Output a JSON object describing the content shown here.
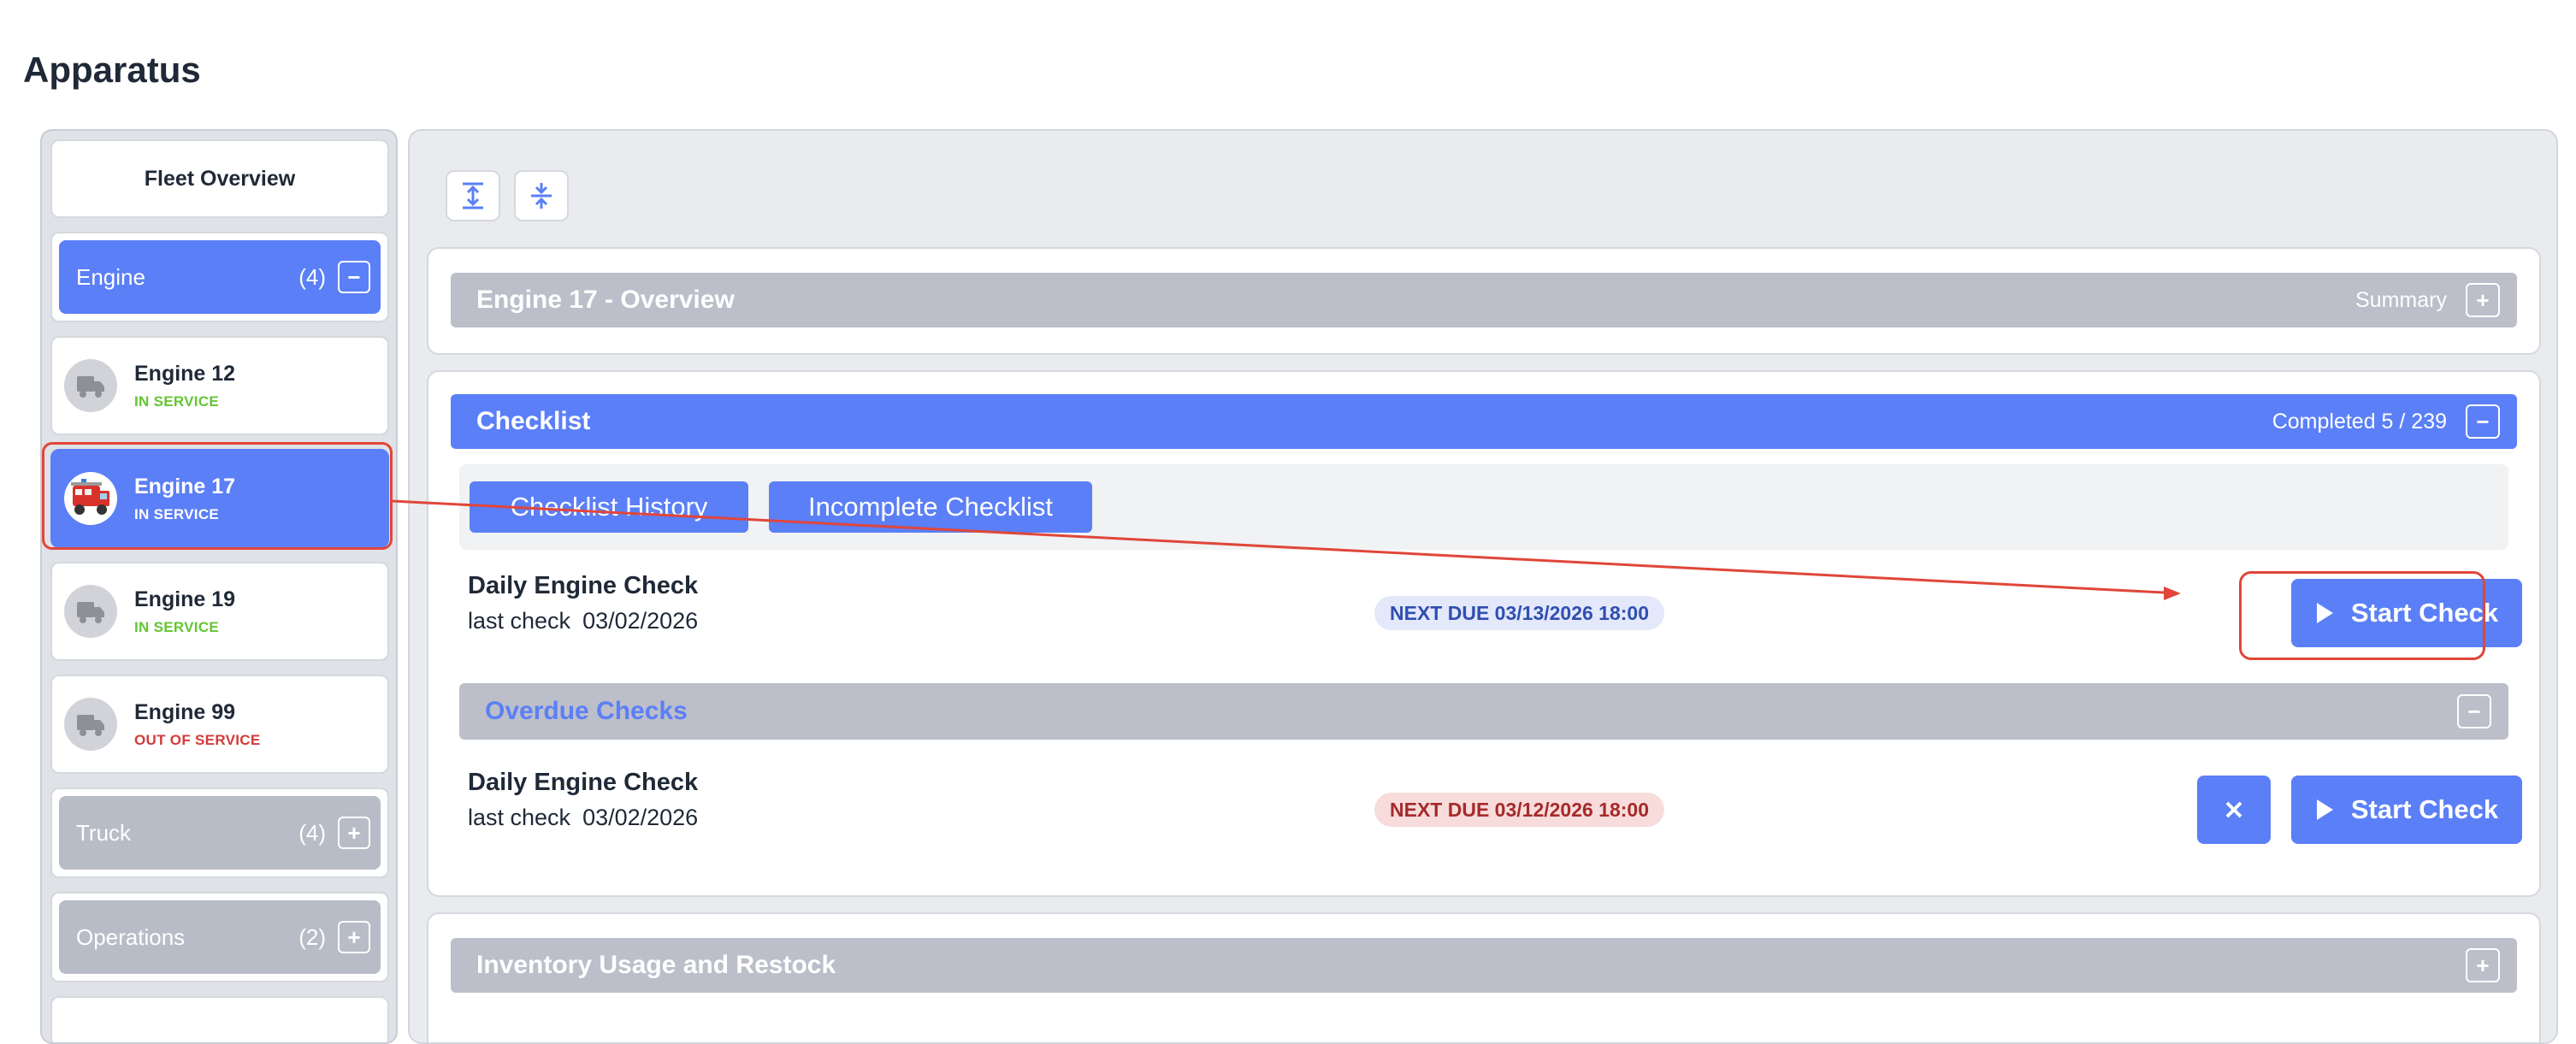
{
  "page": {
    "title": "Apparatus"
  },
  "sidebar": {
    "fleet_overview": "Fleet Overview",
    "groups": [
      {
        "label": "Engine",
        "count": "(4)",
        "toggle": "−",
        "expanded": true
      },
      {
        "label": "Truck",
        "count": "(4)",
        "toggle": "+",
        "expanded": false
      },
      {
        "label": "Operations",
        "count": "(2)",
        "toggle": "+",
        "expanded": false
      }
    ],
    "units": [
      {
        "name": "Engine 12",
        "status": "IN SERVICE",
        "icon": "truck-icon",
        "selected": false
      },
      {
        "name": "Engine 17",
        "status": "IN SERVICE",
        "icon": "fire-engine-photo",
        "selected": true
      },
      {
        "name": "Engine 19",
        "status": "IN SERVICE",
        "icon": "truck-icon",
        "selected": false
      },
      {
        "name": "Engine 99",
        "status": "OUT OF SERVICE",
        "icon": "truck-icon",
        "selected": false
      }
    ]
  },
  "toolbar": {
    "expand_all_icon": "expand-all-icon",
    "collapse_all_icon": "collapse-all-icon"
  },
  "overview": {
    "title": "Engine 17 - Overview",
    "summary_label": "Summary",
    "toggle": "+"
  },
  "checklist": {
    "title": "Checklist",
    "completed": "Completed 5 / 239",
    "toggle": "−",
    "tabs": [
      "Checklist History",
      "Incomplete Checklist"
    ],
    "items": [
      {
        "name": "Daily Engine Check",
        "last_label": "last check",
        "last_date": "03/02/2026",
        "next_due": "NEXT DUE 03/13/2026 18:00",
        "start_label": "Start Check"
      }
    ],
    "overdue": {
      "title": "Overdue Checks",
      "toggle": "−",
      "items": [
        {
          "name": "Daily Engine Check",
          "last_label": "last check",
          "last_date": "03/02/2026",
          "next_due": "NEXT DUE 03/12/2026 18:00",
          "start_label": "Start Check"
        }
      ]
    }
  },
  "inventory": {
    "title": "Inventory Usage and Restock",
    "toggle": "+"
  },
  "colors": {
    "accent": "#5b7ff7",
    "in_service": "#65c534",
    "out_of_service": "#d33a3a",
    "annotation": "#e0463a"
  }
}
